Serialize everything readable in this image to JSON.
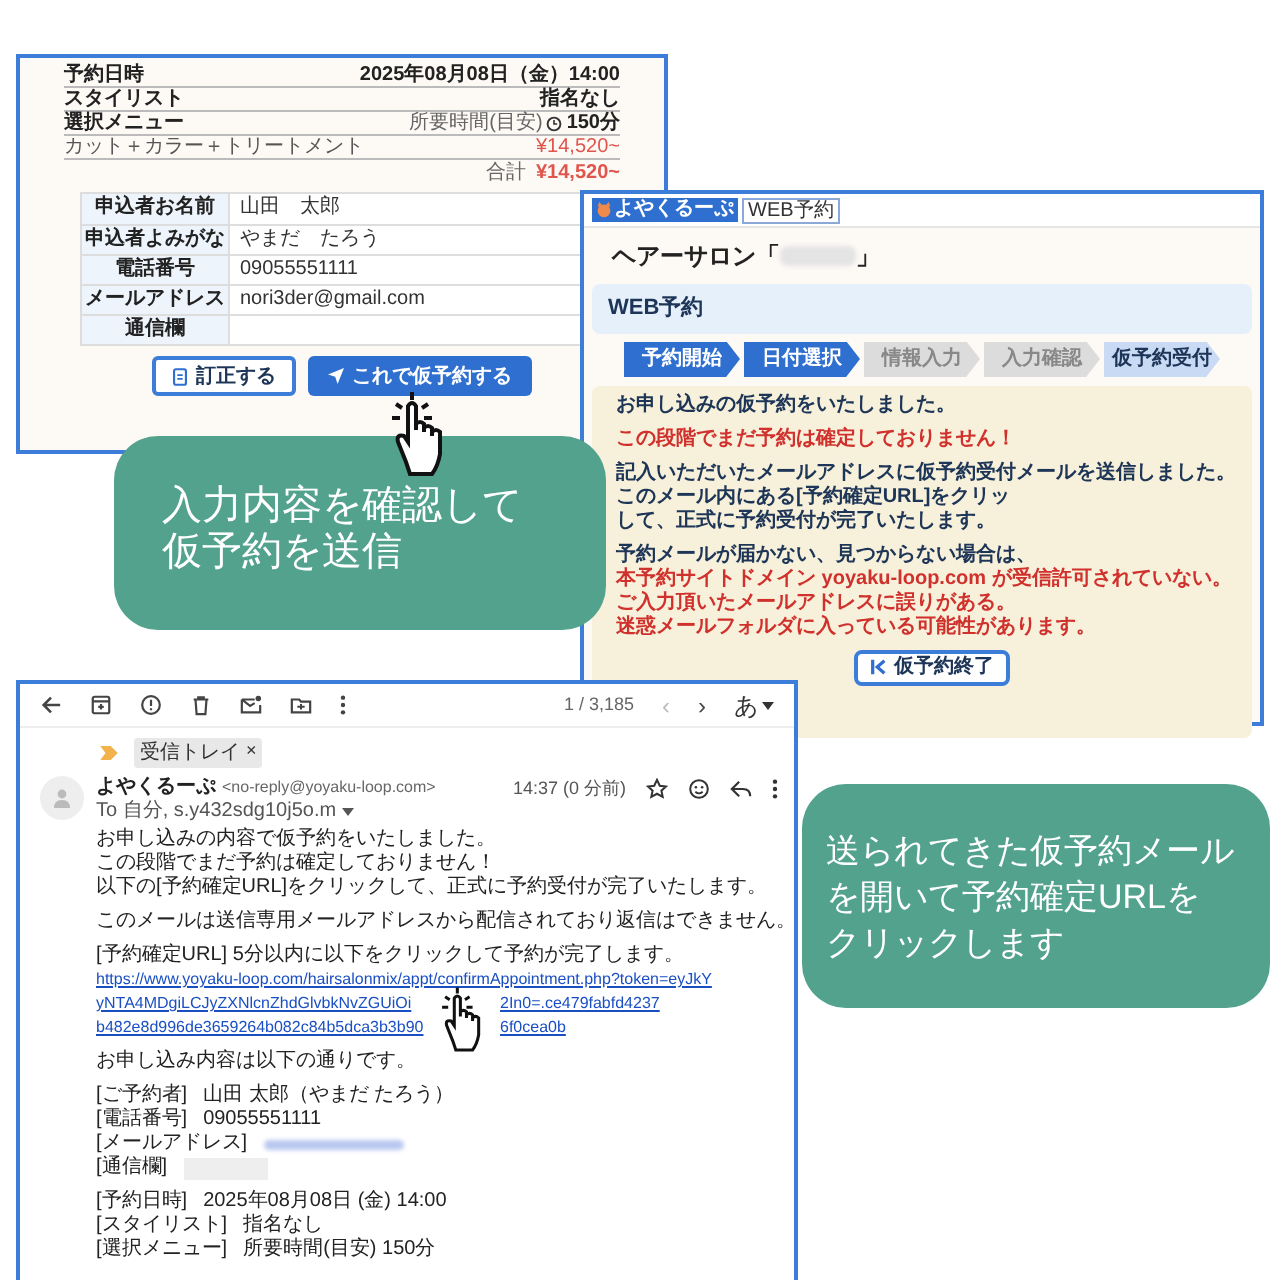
{
  "confirm_page": {
    "summary": [
      {
        "kind": "plain",
        "label": "予約日時",
        "value": "2025年08月08日（金）14:00"
      },
      {
        "kind": "plain",
        "label": "スタイリスト",
        "value": "指名なし"
      },
      {
        "kind": "duration",
        "label": "選択メニュー",
        "note": "所要時間(目安)",
        "value": "150分"
      },
      {
        "kind": "item",
        "label": "カット＋カラー＋トリートメント",
        "value": "¥14,520~"
      }
    ],
    "total": {
      "label": "合計",
      "value": "¥14,520~"
    },
    "applicant": [
      {
        "label": "申込者お名前",
        "value": "山田　太郎"
      },
      {
        "label": "申込者よみがな",
        "value": "やまだ　たろう"
      },
      {
        "label": "電話番号",
        "value": "09055551111"
      },
      {
        "label": "メールアドレス",
        "value": "nori3der@gmail.com"
      },
      {
        "label": "通信欄"
      }
    ],
    "buttons": [
      {
        "kind": "secondary",
        "label": "訂正する"
      },
      {
        "kind": "primary",
        "label": "これで仮予約する"
      }
    ]
  },
  "booking_page": {
    "logo": "よやくるーぷ",
    "badge": "WEB予約",
    "title_prefix": "ヘアーサロン「",
    "title_suffix": "」",
    "section": "WEB予約",
    "steps": [
      {
        "label": "予約開始",
        "kind": "done"
      },
      {
        "label": "日付選択",
        "kind": "done"
      },
      {
        "label": "情報入力",
        "kind": "pending"
      },
      {
        "label": "入力確認",
        "kind": "pending"
      },
      {
        "label": "仮予約受付",
        "kind": "current"
      }
    ],
    "paragraphs": [
      [
        {
          "kind": "normal",
          "text": "お申し込みの仮予約をいたしました。"
        }
      ],
      [
        {
          "kind": "warning",
          "text": "この段階でまだ予約は確定しておりません！"
        }
      ],
      [
        {
          "kind": "normal",
          "text": "記入いただいたメールアドレスに仮予約受付メールを送信しました。このメール内にある[予約確定URL]をクリッ"
        },
        {
          "kind": "normal",
          "text": "して、正式に予約受付が完了いたします。"
        }
      ],
      [
        {
          "kind": "normal",
          "text": "予約メールが届かない、見つからない場合は、"
        },
        {
          "kind": "warning",
          "text": "本予約サイトドメイン yoyaku-loop.com が受信許可されていない。"
        },
        {
          "kind": "warning",
          "text": "ご入力頂いたメールアドレスに誤りがある。"
        },
        {
          "kind": "warning",
          "text": "迷惑メールフォルダに入っている可能性があります。"
        }
      ]
    ],
    "end_button": "仮予約終了"
  },
  "email": {
    "counter": "1 / 3,185",
    "prev": "‹",
    "next": "›",
    "input_mode": "あ",
    "tag": "受信トレイ",
    "tag_close": "×",
    "sender": "よやくるーぷ",
    "address": "<no-reply@yoyaku-loop.com>",
    "time": "14:37 (0 分前)",
    "to": "To 自分, s.y432sdg10j5o.m",
    "paragraphs": [
      [
        {
          "kind": "text",
          "text": "お申し込みの内容で仮予約をいたしました。"
        },
        {
          "kind": "text",
          "text": "この段階でまだ予約は確定しておりません！"
        },
        {
          "kind": "text",
          "text": "以下の[予約確定URL]をクリックして、正式に予約受付が完了いたします。"
        }
      ],
      [
        {
          "kind": "text",
          "text": "このメールは送信専用メールアドレスから配信されており返信はできません。"
        }
      ],
      [
        {
          "kind": "text",
          "text": "[予約確定URL] 5分以内に以下をクリックして予約が完了します。"
        },
        {
          "kind": "link",
          "text": "https://www.yoyaku-loop.com/hairsalonmix/appt/confirmAppointment.php?token=eyJkY"
        },
        {
          "kind": "split_link",
          "text": "yNTA4MDgiLCJyZXNlcnZhdGlvbkNvZGUiOi",
          "rest": "2In0=.ce479fabfd4237"
        },
        {
          "kind": "split_link",
          "text": "b482e8d996de3659264b082c84b5dca3b3b90",
          "rest": "6f0cea0b"
        }
      ],
      [
        {
          "kind": "text",
          "text": "お申し込み内容は以下の通りです。"
        }
      ],
      [
        {
          "kind": "field",
          "label": "[ご予約者]",
          "text": "山田 太郎（やまだ たろう）"
        },
        {
          "kind": "field",
          "label": "[電話番号]",
          "text": "09055551111"
        },
        {
          "kind": "blurred",
          "label": "[メールアドレス]"
        },
        {
          "kind": "empty",
          "label": "[通信欄]"
        }
      ],
      [
        {
          "kind": "field",
          "label": "[予約日時]",
          "text": "2025年08月08日 (金) 14:00"
        },
        {
          "kind": "field",
          "label": "[スタイリスト]",
          "text": "指名なし"
        },
        {
          "kind": "field",
          "label": "[選択メニュー]",
          "text": "所要時間(目安) 150分"
        }
      ]
    ]
  },
  "callouts": [
    {
      "lines": [
        "入力内容を確認して",
        "仮予約を送信"
      ]
    },
    {
      "lines": [
        "送られてきた仮予約メール",
        "を開いて予約確定URLを",
        "クリックします"
      ]
    }
  ]
}
